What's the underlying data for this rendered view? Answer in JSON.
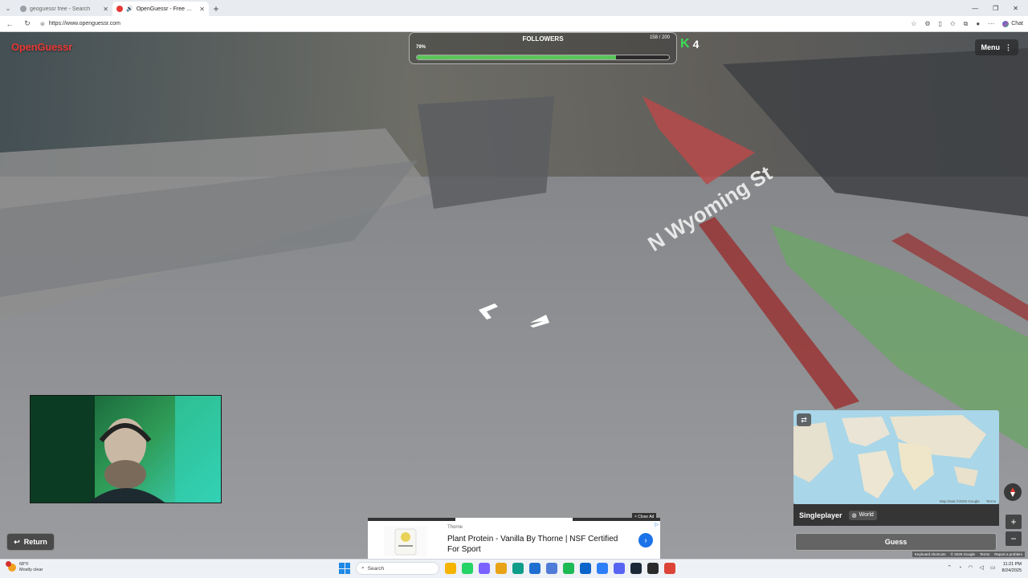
{
  "browser": {
    "tabs": [
      {
        "title": "geoguessr free - Search",
        "active": false,
        "favicon_color": "#8a8a8a"
      },
      {
        "title": "OpenGuessr - Free GeoGuessr",
        "active": true,
        "favicon_color": "#e53935"
      }
    ],
    "url": "https://www.openguessr.com",
    "chat_label": "Chat"
  },
  "game": {
    "brand": "OpenGuessr",
    "followers": {
      "title": "FOLLOWERS",
      "percent_label": "79%",
      "count_label": "158 / 200",
      "progress": 0.79
    },
    "streak": "4",
    "menu_label": "Menu",
    "street_sign": "N Wyoming St",
    "return_label": "Return",
    "mode_label": "Singleplayer",
    "region_label": "World",
    "guess_label": "Guess",
    "map_attribution": [
      "Map Data ©2025 Google",
      "Terms"
    ],
    "footer_links": [
      "Keyboard shortcuts",
      "© 2025 Google",
      "Terms",
      "Report a problem"
    ]
  },
  "ad": {
    "close_label": "× Close Ad",
    "brand": "Thorne",
    "title": "Plant Protein - Vanilla By Thorne | NSF Certified For Sport"
  },
  "taskbar": {
    "weather_temp": "68°F",
    "weather_desc": "Mostly clear",
    "search_placeholder": "Search",
    "time": "11:21 PM",
    "date": "8/24/2025",
    "apps": [
      {
        "name": "file-explorer",
        "color": "#f4b400"
      },
      {
        "name": "whatsapp",
        "color": "#25d366"
      },
      {
        "name": "copilot",
        "color": "#7b61ff"
      },
      {
        "name": "folders",
        "color": "#e8a317"
      },
      {
        "name": "edge",
        "color": "#0f9d8a"
      },
      {
        "name": "calculator",
        "color": "#1f6fd1"
      },
      {
        "name": "notepad",
        "color": "#4f7bd9"
      },
      {
        "name": "spotify",
        "color": "#1db954"
      },
      {
        "name": "outlook",
        "color": "#0a64c9"
      },
      {
        "name": "store",
        "color": "#2d7ff9"
      },
      {
        "name": "discord",
        "color": "#5865f2"
      },
      {
        "name": "steam",
        "color": "#1b2838"
      },
      {
        "name": "terminal",
        "color": "#2b2b2b"
      },
      {
        "name": "chrome",
        "color": "#db4437"
      }
    ]
  }
}
